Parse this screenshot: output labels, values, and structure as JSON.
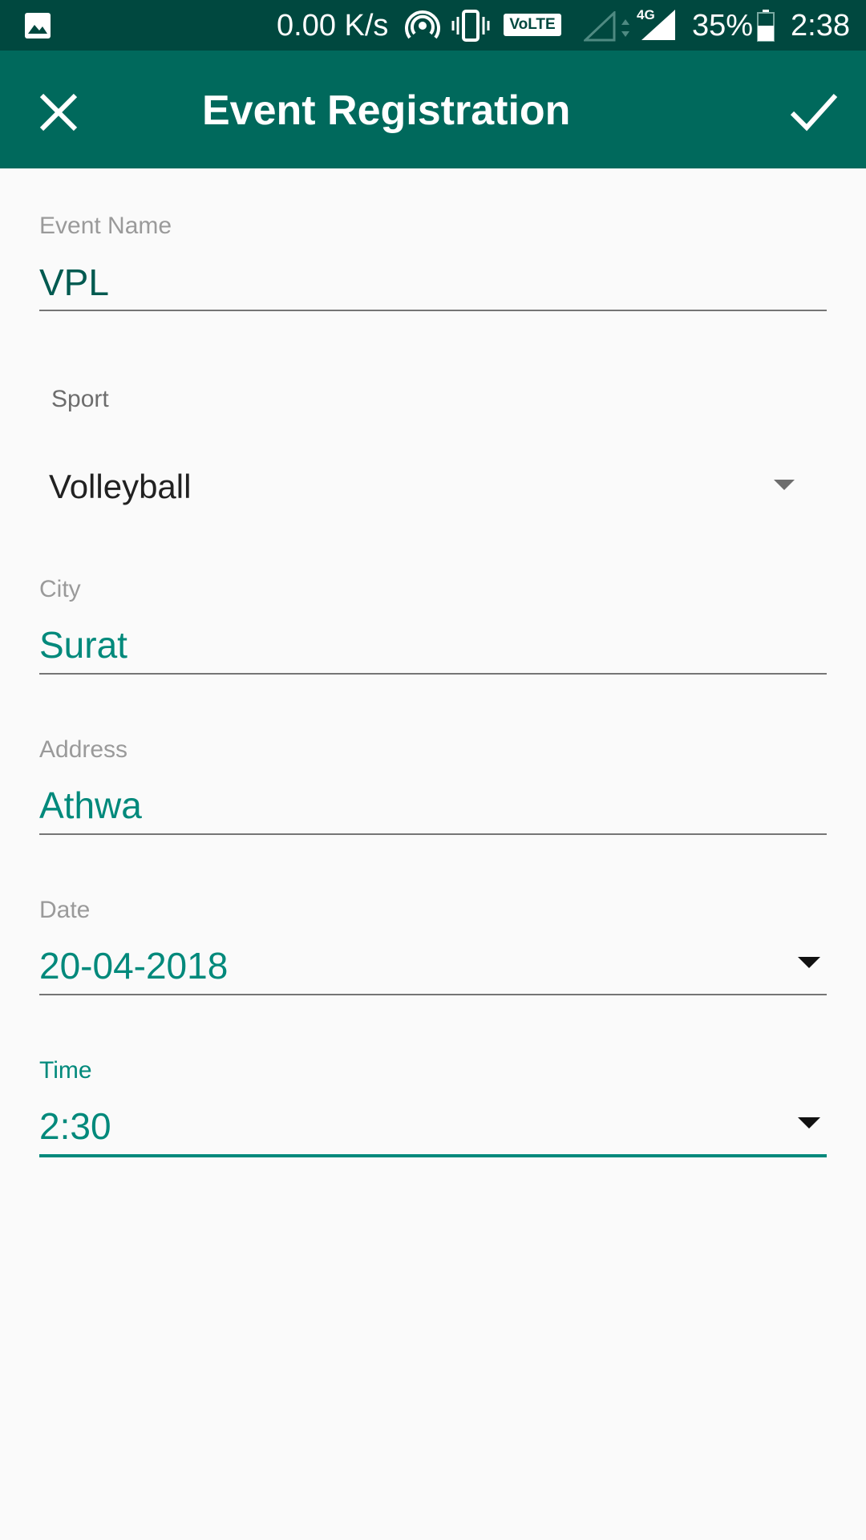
{
  "status_bar": {
    "net_speed": "0.00 K/s",
    "volte": "VoLTE",
    "net_type": "4G",
    "battery": "35%",
    "time": "2:38",
    "icons": [
      "gallery-icon",
      "hotspot-icon",
      "vibrate-icon",
      "signal-empty-icon",
      "data-arrows-icon",
      "signal-4g-icon",
      "battery-icon"
    ]
  },
  "app_bar": {
    "title": "Event Registration",
    "close_icon": "close-icon",
    "confirm_icon": "check-icon"
  },
  "form": {
    "event_name": {
      "label": "Event Name",
      "value": "VPL"
    },
    "sport": {
      "label": "Sport",
      "value": "Volleyball"
    },
    "city": {
      "label": "City",
      "value": "Surat"
    },
    "address": {
      "label": "Address",
      "value": "Athwa"
    },
    "date": {
      "label": "Date",
      "value": "20-04-2018"
    },
    "time": {
      "label": "Time",
      "value": "2:30"
    }
  },
  "colors": {
    "status_bar": "#00483f",
    "app_bar": "#00695c",
    "accent": "#00897b",
    "background": "#fafafa"
  }
}
